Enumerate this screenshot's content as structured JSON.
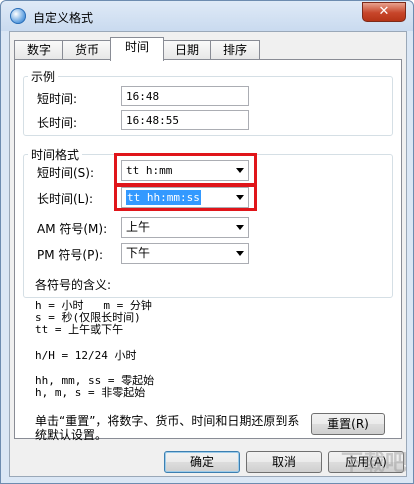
{
  "window": {
    "title": "自定义格式",
    "close_label": "✕"
  },
  "tabs": [
    {
      "label": "数字"
    },
    {
      "label": "货币"
    },
    {
      "label": "时间"
    },
    {
      "label": "日期"
    },
    {
      "label": "排序"
    }
  ],
  "example": {
    "legend": "示例",
    "short_label": "短时间:",
    "short_value": "16:48",
    "long_label": "长时间:",
    "long_value": "16:48:55"
  },
  "format": {
    "legend": "时间格式",
    "short_label": "短时间(S):",
    "short_value": "tt h:mm",
    "long_label": "长时间(L):",
    "long_value": "tt hh:mm:ss",
    "am_label": "AM 符号(M):",
    "am_value": "上午",
    "pm_label": "PM 符号(P):",
    "pm_value": "下午"
  },
  "notes": {
    "heading": "各符号的含义:",
    "line1": "h = 小时   m = 分钟",
    "line2": "s = 秒(仅限长时间)",
    "line3": "tt = 上午或下午",
    "line4": "h/H = 12/24 小时",
    "line5": "hh, mm, ss = 零起始",
    "line6": "h, m, s = 非零起始"
  },
  "footer": {
    "text_line1": "单击“重置”，将数字、货币、时间和日期还原到系",
    "text_line2": "统默认设置。",
    "reset_label": "重置(R)",
    "ok_label": "确定",
    "cancel_label": "取消",
    "apply_label": "应用(A)"
  },
  "watermark": "下载吧",
  "colors": {
    "highlight_border": "#e0151a",
    "selection": "#3399ff"
  }
}
